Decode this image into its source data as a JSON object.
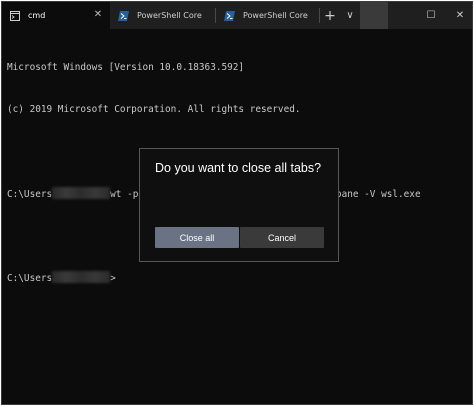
{
  "window": {
    "tabs": [
      {
        "label": "cmd",
        "icon": "cmd-icon",
        "active": true
      },
      {
        "label": "PowerShell Core",
        "icon": "powershell-icon",
        "active": false
      },
      {
        "label": "PowerShell Core",
        "icon": "powershell-icon",
        "active": false
      }
    ],
    "new_tab_symbol": "+",
    "dropdown_symbol": "∨",
    "minimize_symbol": "—",
    "maximize_symbol": "☐",
    "close_symbol": "✕",
    "tab_close_symbol": "✕"
  },
  "terminal": {
    "line1": "Microsoft Windows [Version 10.0.18363.592]",
    "line2": "(c) 2019 Microsoft Corporation. All rights reserved.",
    "prompt1_prefix": "C:\\Users",
    "prompt1_command": "wt -p \"Windows PowerShell\" -d . ; split-pane -V wsl.exe",
    "prompt2_prefix": "C:\\Users",
    "prompt2_suffix": ">"
  },
  "dialog": {
    "title": "Do you want to close all tabs?",
    "primary_label": "Close all",
    "secondary_label": "Cancel"
  },
  "colors": {
    "terminal_bg": "#0c0c0c",
    "tabbar_bg": "#1f1f1f",
    "primary_button": "#6a7383",
    "secondary_button": "#3a3a3a"
  }
}
